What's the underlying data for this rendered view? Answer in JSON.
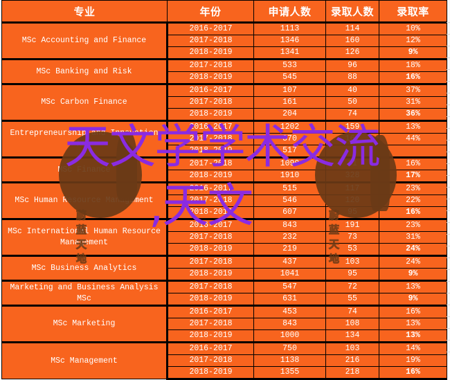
{
  "table": {
    "headers": [
      "专业",
      "年份",
      "申请人数",
      "录取人数",
      "录取率"
    ],
    "groups": [
      {
        "major": "MSc Accounting  and Finance",
        "rows": [
          {
            "year": "2016-2017",
            "applicants": "1113",
            "admitted": "114",
            "rate": "10%",
            "bold": false
          },
          {
            "year": "2017-2018",
            "applicants": "1346",
            "admitted": "160",
            "rate": "12%",
            "bold": false
          },
          {
            "year": "2018-2019",
            "applicants": "1341",
            "admitted": "126",
            "rate": "9%",
            "bold": true
          }
        ]
      },
      {
        "major": "MSc Banking  and Risk",
        "rows": [
          {
            "year": "2017-2018",
            "applicants": "533",
            "admitted": "96",
            "rate": "18%",
            "bold": false
          },
          {
            "year": "2018-2019",
            "applicants": "545",
            "admitted": "88",
            "rate": "16%",
            "bold": true
          }
        ]
      },
      {
        "major": "MSc Carbon Finance",
        "rows": [
          {
            "year": "2016-2017",
            "applicants": "107",
            "admitted": "40",
            "rate": "37%",
            "bold": false
          },
          {
            "year": "2017-2018",
            "applicants": "161",
            "admitted": "50",
            "rate": "31%",
            "bold": false
          },
          {
            "year": "2018-2019",
            "applicants": "204",
            "admitted": "74",
            "rate": "36%",
            "bold": true
          }
        ]
      },
      {
        "major": "Entrepreneurship and Innovation MSc",
        "rows": [
          {
            "year": "2016-2017",
            "applicants": "1202",
            "admitted": "159",
            "rate": "13%",
            "bold": false
          },
          {
            "year": "2017-2018",
            "applicants": "370",
            "admitted": "161",
            "rate": "44%",
            "bold": false
          },
          {
            "year": "2018-2019",
            "applicants": "517",
            "admitted": "",
            "rate": "",
            "bold": true
          }
        ]
      },
      {
        "major": "MSc Finance",
        "rows": [
          {
            "year": "2017-2018",
            "applicants": "1090",
            "admitted": "31",
            "rate": "16%",
            "bold": false
          },
          {
            "year": "2018-2019",
            "applicants": "1910",
            "admitted": "328",
            "rate": "17%",
            "bold": true
          }
        ]
      },
      {
        "major": "MSc Human Resource Management",
        "rows": [
          {
            "year": "2016-2017",
            "applicants": "515",
            "admitted": "117",
            "rate": "23%",
            "bold": false
          },
          {
            "year": "2017-2018",
            "applicants": "546",
            "admitted": "120",
            "rate": "22%",
            "bold": false
          },
          {
            "year": "2018-2019",
            "applicants": "607",
            "admitted": "95",
            "rate": "16%",
            "bold": true
          }
        ]
      },
      {
        "major": "MSc International  Human Resource Management",
        "rows": [
          {
            "year": "2016-2017",
            "applicants": "843",
            "admitted": "191",
            "rate": "23%",
            "bold": false
          },
          {
            "year": "2017-2018",
            "applicants": "232",
            "admitted": "73",
            "rate": "31%",
            "bold": false
          },
          {
            "year": "2018-2019",
            "applicants": "219",
            "admitted": "53",
            "rate": "24%",
            "bold": true
          }
        ]
      },
      {
        "major": "MSc  Business Analytics",
        "rows": [
          {
            "year": "2017-2018",
            "applicants": "437",
            "admitted": "103",
            "rate": "24%",
            "bold": false
          },
          {
            "year": "2018-2019",
            "applicants": "1041",
            "admitted": "95",
            "rate": "9%",
            "bold": true
          }
        ]
      },
      {
        "major": "Marketing  and Business Analysis MSc",
        "rows": [
          {
            "year": "2017-2018",
            "applicants": "547",
            "admitted": "72",
            "rate": "13%",
            "bold": false
          },
          {
            "year": "2018-2019",
            "applicants": "631",
            "admitted": "55",
            "rate": "9%",
            "bold": true
          }
        ]
      },
      {
        "major": "MSc Marketing",
        "rows": [
          {
            "year": "2016-2017",
            "applicants": "453",
            "admitted": "74",
            "rate": "16%",
            "bold": false
          },
          {
            "year": "2017-2018",
            "applicants": "843",
            "admitted": "108",
            "rate": "13%",
            "bold": false
          },
          {
            "year": "2018-2019",
            "applicants": "1000",
            "admitted": "134",
            "rate": "13%",
            "bold": true
          }
        ]
      },
      {
        "major": "MSc Management",
        "rows": [
          {
            "year": "2016-2017",
            "applicants": "750",
            "admitted": "103",
            "rate": "14%",
            "bold": false
          },
          {
            "year": "2017-2018",
            "applicants": "1138",
            "admitted": "216",
            "rate": "19%",
            "bold": false
          },
          {
            "year": "2018-2019",
            "applicants": "1355",
            "admitted": "218",
            "rate": "16%",
            "bold": true
          }
        ]
      }
    ]
  },
  "watermark": {
    "text": "蔚蓝天地",
    "icon": "globe-icon"
  },
  "overlay": {
    "line1": "天文学学术交流",
    "line2": ",天文"
  },
  "colors": {
    "cell_bg": "#f8641e",
    "overlay_text": "#8a2be2",
    "watermark": "#6a3a16"
  }
}
